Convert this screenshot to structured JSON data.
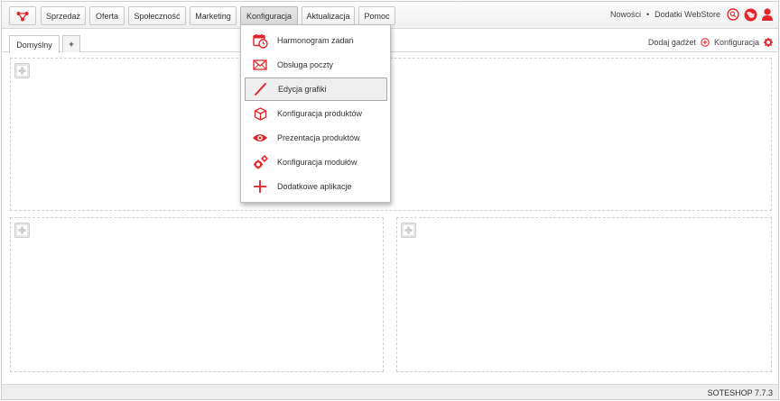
{
  "nav": {
    "items": [
      {
        "label": "Sprzedaż",
        "active": false
      },
      {
        "label": "Oferta",
        "active": false
      },
      {
        "label": "Społeczność",
        "active": false
      },
      {
        "label": "Marketing",
        "active": false
      },
      {
        "label": "Konfiguracja",
        "active": true
      },
      {
        "label": "Aktualizacja",
        "active": false
      },
      {
        "label": "Pomoc",
        "active": false
      }
    ],
    "links": {
      "news": "Nowości",
      "separator": "•",
      "webstore": "Dodatki WebStore"
    }
  },
  "tabs": {
    "items": [
      {
        "label": "Domyślny"
      },
      {
        "label": "+"
      }
    ]
  },
  "gadgets": {
    "add_label": "Dodaj gadżet",
    "config_label": "Konfiguracja"
  },
  "dropdown": {
    "items": [
      {
        "label": "Harmonogram zadań",
        "icon": "calendar-clock-icon"
      },
      {
        "label": "Obsługa poczty",
        "icon": "envelope-icon"
      },
      {
        "label": "Edycja grafiki",
        "icon": "pencil-icon"
      },
      {
        "label": "Konfiguracja produktów",
        "icon": "box-icon"
      },
      {
        "label": "Prezentacja produktów",
        "icon": "eye-icon"
      },
      {
        "label": "Konfiguracja modułów",
        "icon": "gears-icon"
      },
      {
        "label": "Dodatkowe aplikacje",
        "icon": "plus-icon"
      }
    ]
  },
  "footer": {
    "version": "SOTESHOP 7.7.3"
  },
  "colors": {
    "accent": "#e3252a",
    "hover_bg": "#eeeeee"
  }
}
